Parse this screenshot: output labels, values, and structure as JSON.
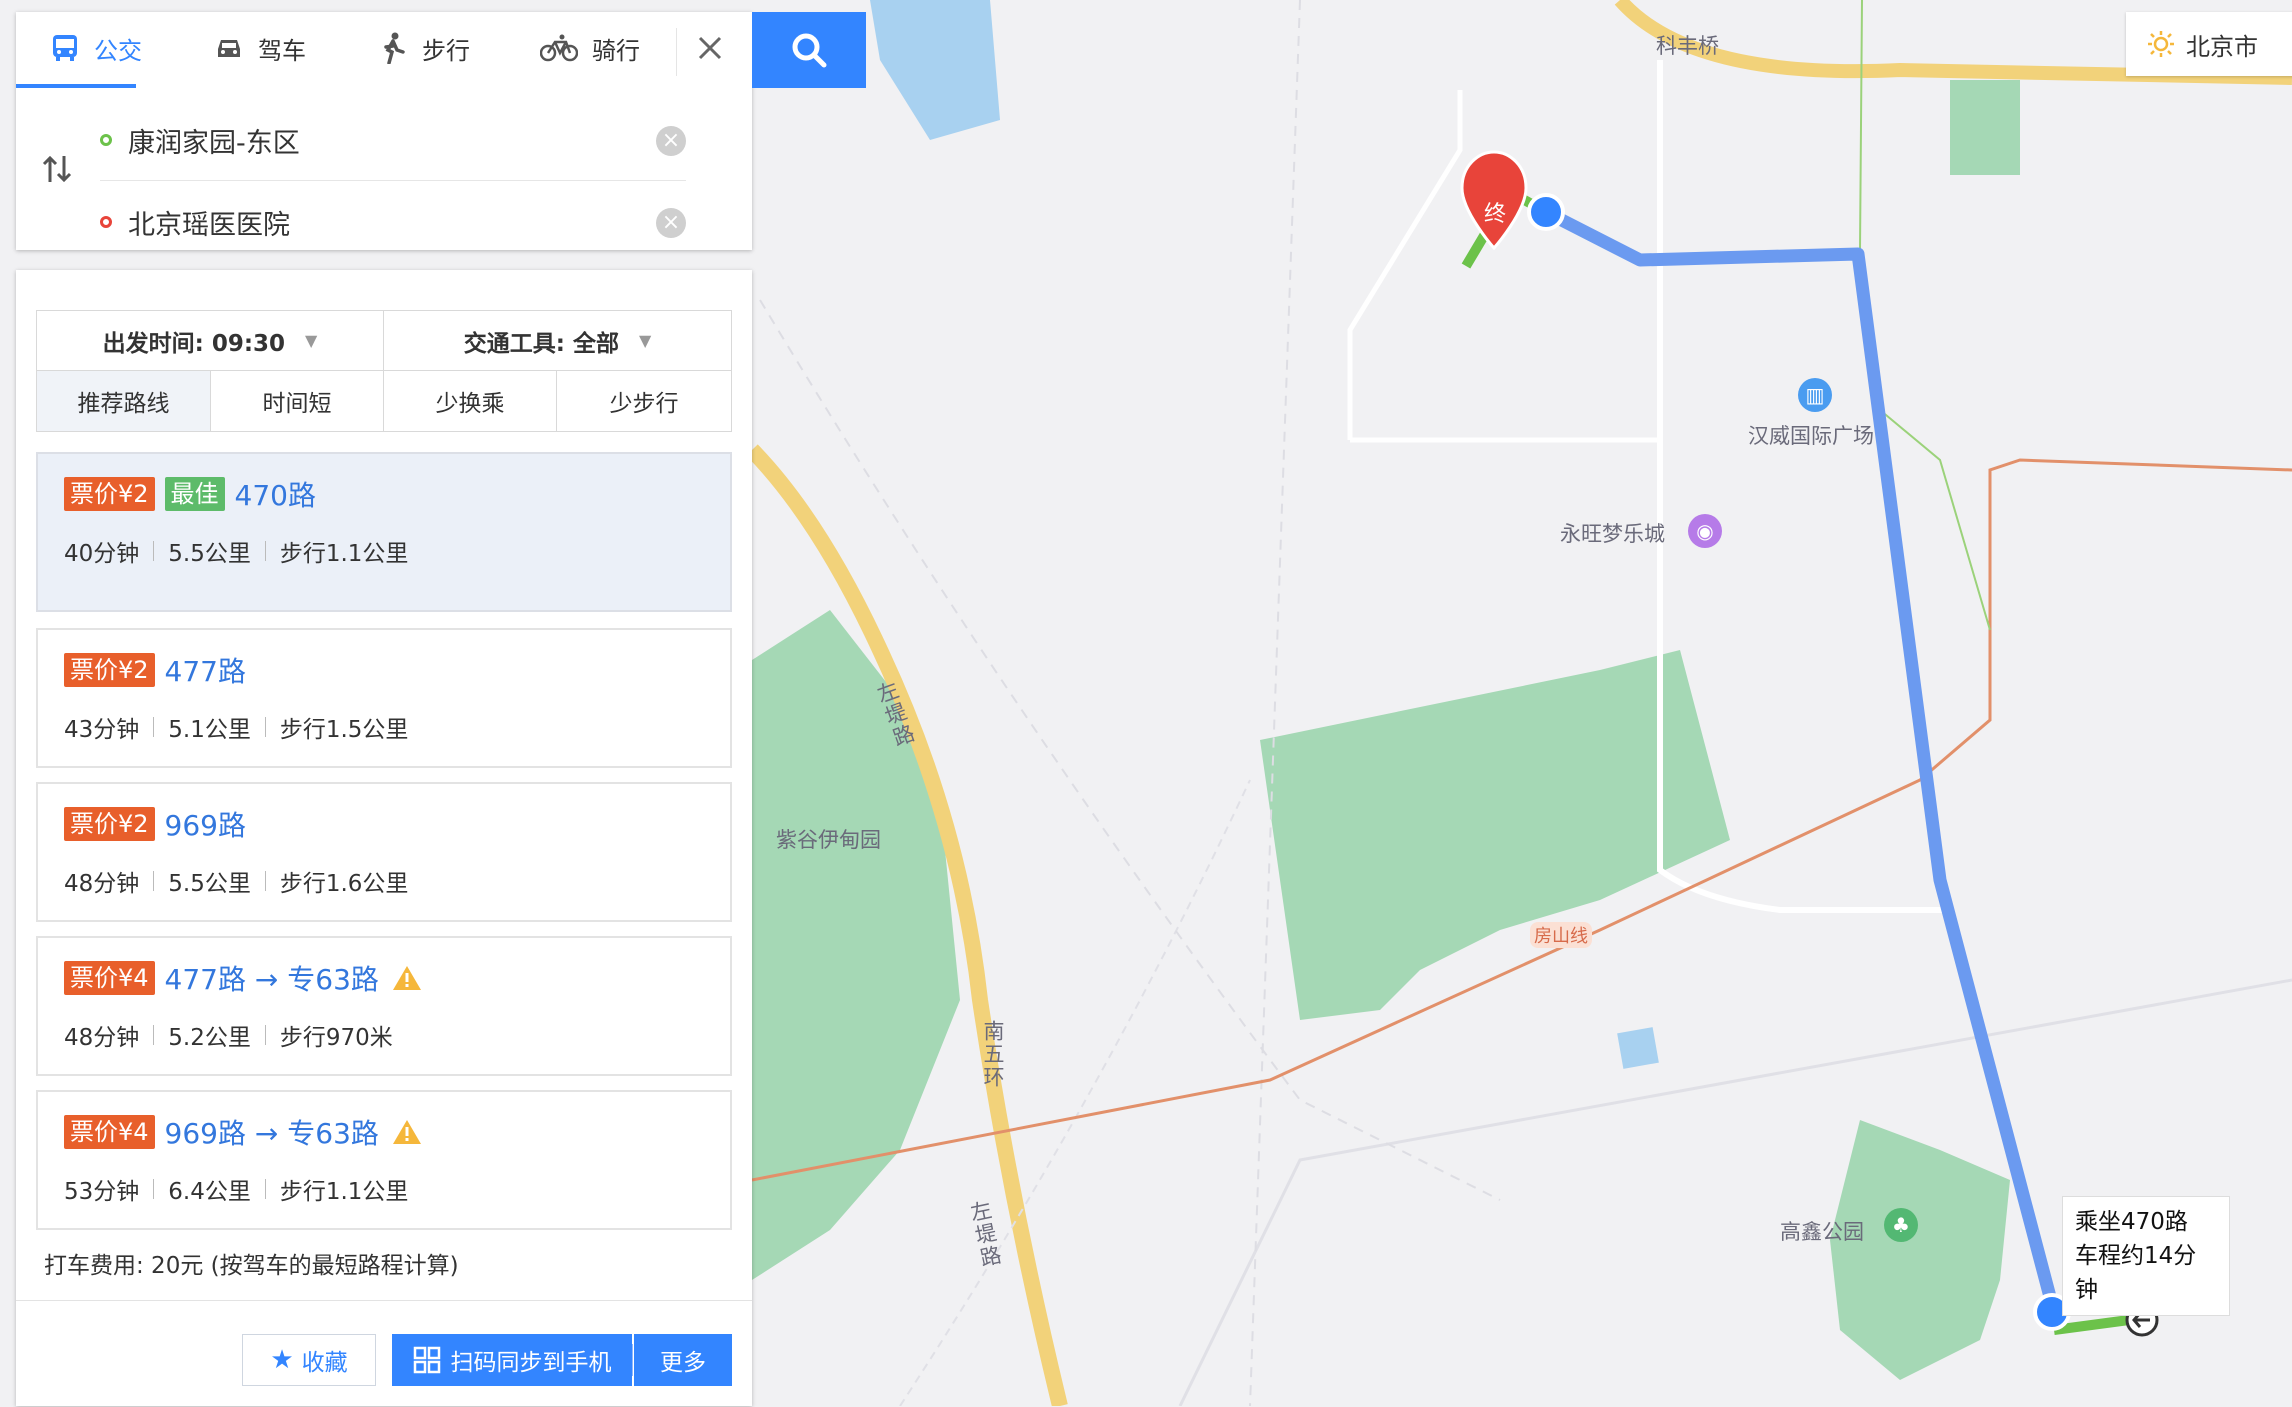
{
  "tabs": [
    {
      "label": "公交",
      "active": true,
      "icon": "bus-icon"
    },
    {
      "label": "驾车",
      "active": false,
      "icon": "car-icon"
    },
    {
      "label": "步行",
      "active": false,
      "icon": "walk-icon"
    },
    {
      "label": "骑行",
      "active": false,
      "icon": "bike-icon"
    }
  ],
  "origin": "康润家园-东区",
  "destination": "北京瑶医医院",
  "options": {
    "depart_time": "出发时间: 09:30",
    "transport": "交通工具: 全部",
    "sort_tabs": [
      "推荐路线",
      "时间短",
      "少换乘",
      "少步行"
    ]
  },
  "routes": [
    {
      "price": "票价¥2",
      "best": "最佳",
      "name": "470路",
      "time": "40分钟",
      "distance": "5.5公里",
      "walk": "步行1.1公里",
      "warning": false,
      "selected": true
    },
    {
      "price": "票价¥2",
      "best": "",
      "name": "477路",
      "time": "43分钟",
      "distance": "5.1公里",
      "walk": "步行1.5公里",
      "warning": false,
      "selected": false
    },
    {
      "price": "票价¥2",
      "best": "",
      "name": "969路",
      "time": "48分钟",
      "distance": "5.5公里",
      "walk": "步行1.6公里",
      "warning": false,
      "selected": false
    },
    {
      "price": "票价¥4",
      "best": "",
      "name": "477路 → 专63路",
      "time": "48分钟",
      "distance": "5.2公里",
      "walk": "步行970米",
      "warning": true,
      "selected": false
    },
    {
      "price": "票价¥4",
      "best": "",
      "name": "969路 → 专63路",
      "time": "53分钟",
      "distance": "6.4公里",
      "walk": "步行1.1公里",
      "warning": true,
      "selected": false
    }
  ],
  "taxi": "打车费用: 20元 (按驾车的最短路程计算)",
  "buttons": {
    "favorite": "收藏",
    "sync": "扫码同步到手机",
    "more": "更多"
  },
  "city": "北京市",
  "map": {
    "labels": [
      "科丰桥",
      "汉威国际广场",
      "永旺梦乐城",
      "紫谷伊甸园",
      "房山线",
      "高鑫公园",
      "左堤路",
      "南五环",
      "左堤路"
    ],
    "end_marker": "终",
    "tooltip": [
      "乘坐470路",
      "车程约14分钟"
    ]
  },
  "colors": {
    "accent": "#3385ff",
    "price_badge": "#e85f2b",
    "best_badge": "#5dbb6a",
    "bus_route": "#6b9af0",
    "walk_route": "#6cc24a"
  }
}
